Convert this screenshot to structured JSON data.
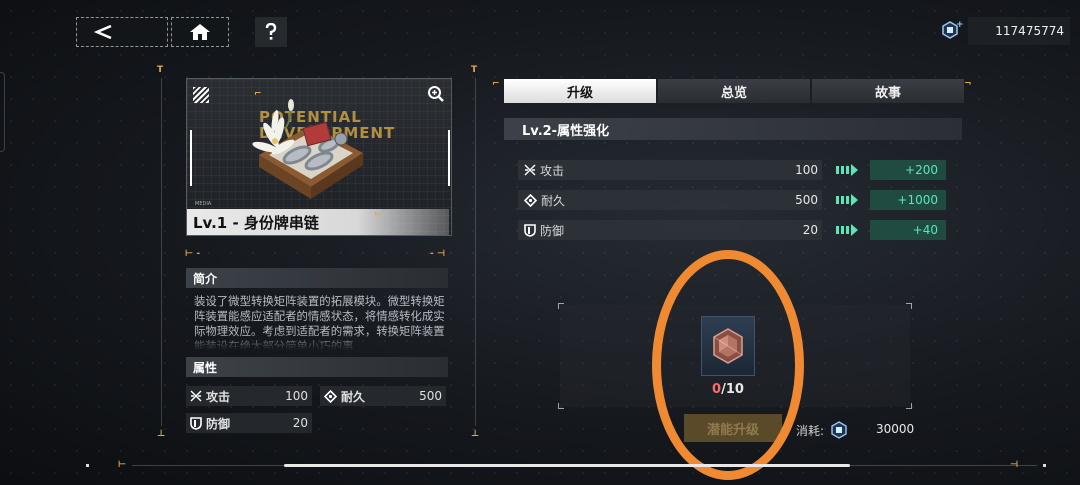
{
  "header": {
    "currency_amount": "117475774"
  },
  "item": {
    "card_title": "Lv.1 - 身份牌串链",
    "background_text": "POTENTIAL DEVELOPMENT",
    "media_tag": "MEDIA"
  },
  "left_panel": {
    "intro_heading": "简介",
    "description": "装设了微型转换矩阵装置的拓展模块。微型转换矩阵装置能感应适配者的情感状态，将情感转化成实际物理效应。考虑到适配者的需求，转换矩阵装置能装设在绝大部分简单小巧的事",
    "attr_heading": "属性",
    "attributes": [
      {
        "label": "攻击",
        "value": "100",
        "icon": "attack-icon"
      },
      {
        "label": "耐久",
        "value": "500",
        "icon": "durability-icon"
      },
      {
        "label": "防御",
        "value": "20",
        "icon": "defense-icon"
      }
    ]
  },
  "tabs": [
    {
      "label": "升级",
      "active": true
    },
    {
      "label": "总览",
      "active": false
    },
    {
      "label": "故事",
      "active": false
    }
  ],
  "upgrade": {
    "level_title": "Lv.2-属性强化",
    "stats": [
      {
        "label": "攻击",
        "value": "100",
        "bonus": "+200",
        "icon": "attack-icon"
      },
      {
        "label": "耐久",
        "value": "500",
        "bonus": "+1000",
        "icon": "durability-icon"
      },
      {
        "label": "防御",
        "value": "20",
        "bonus": "+40",
        "icon": "defense-icon"
      }
    ],
    "material": {
      "have": "0",
      "need": "/10"
    },
    "button_label": "潜能升级",
    "cost_label": "消耗:",
    "cost_value": "30000"
  },
  "colors": {
    "accent_orange": "#f08a32",
    "bonus_green": "#59e7b8",
    "bonus_bg": "#1f4b40",
    "deficit_red": "#ff6b6b",
    "gold_tick": "#e0a84b"
  }
}
